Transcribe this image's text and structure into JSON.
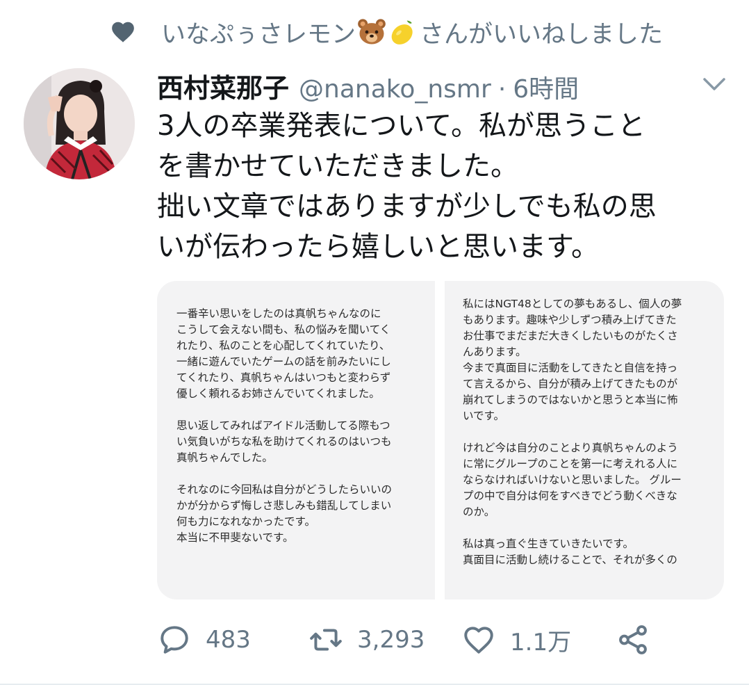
{
  "liked_by": {
    "name": "いなぷぅさレモン",
    "emoji": [
      "bear-face",
      "lemon"
    ],
    "suffix": "さんがいいねしました"
  },
  "tweet": {
    "author_name": "西村菜那子",
    "handle": "@nanako_nsmr",
    "separator": "·",
    "time": "6時間",
    "text_lines": [
      "3人の卒業発表について。私が思うこと",
      "を書かせていただきました。",
      "拙い文章ではありますが少しでも私の思",
      "いが伝わったら嬉しいと思います。"
    ]
  },
  "media": {
    "left_lines": [
      "一番辛い思いをしたのは真帆ちゃんなのに",
      "こうして会えない間も、私の悩みを聞いてく",
      "れたり、私のことを心配してくれていたり、",
      "一緒に遊んでいたゲームの話を前みたいにし",
      "てくれたり、真帆ちゃんはいつもと変わらず",
      "優しく頼れるお姉さんでいてくれました。",
      "",
      "思い返してみればアイドル活動してる際もつ",
      "い気負いがちな私を助けてくれるのはいつも",
      "真帆ちゃんでした。",
      "",
      "それなのに今回私は自分がどうしたらいいの",
      "かが分からず悔しさ悲しみも錯乱してしまい",
      "何も力になれなかったです。",
      "本当に不甲斐ないです。"
    ],
    "right_lines": [
      "私にはNGT48としての夢もあるし、個人の夢",
      "もあります。趣味や少しずつ積み上げてきた",
      "お仕事でまだまだ大きくしたいものがたくさ",
      "んあります。",
      "今まで真面目に活動をしてきたと自信を持っ",
      "て言えるから、自分が積み上げてきたものが",
      "崩れてしまうのではないかと思うと本当に怖",
      "いです。",
      "",
      "けれど今は自分のことより真帆ちゃんのよう",
      "に常にグループのことを第一に考えれる人に",
      "ならなければいけないと思いました。 グルー",
      "プの中で自分は何をすべきでどう動くべきな",
      "のか。",
      "",
      "私は真っ直ぐ生きていきたいです。",
      "真面目に活動し続けることで、それが多くの"
    ]
  },
  "actions": {
    "replies": "483",
    "retweets": "3,293",
    "likes": "1.1万"
  },
  "colors": {
    "secondary_text": "#657786",
    "primary_text": "#14171a",
    "media_bg": "#f3f3f4"
  }
}
